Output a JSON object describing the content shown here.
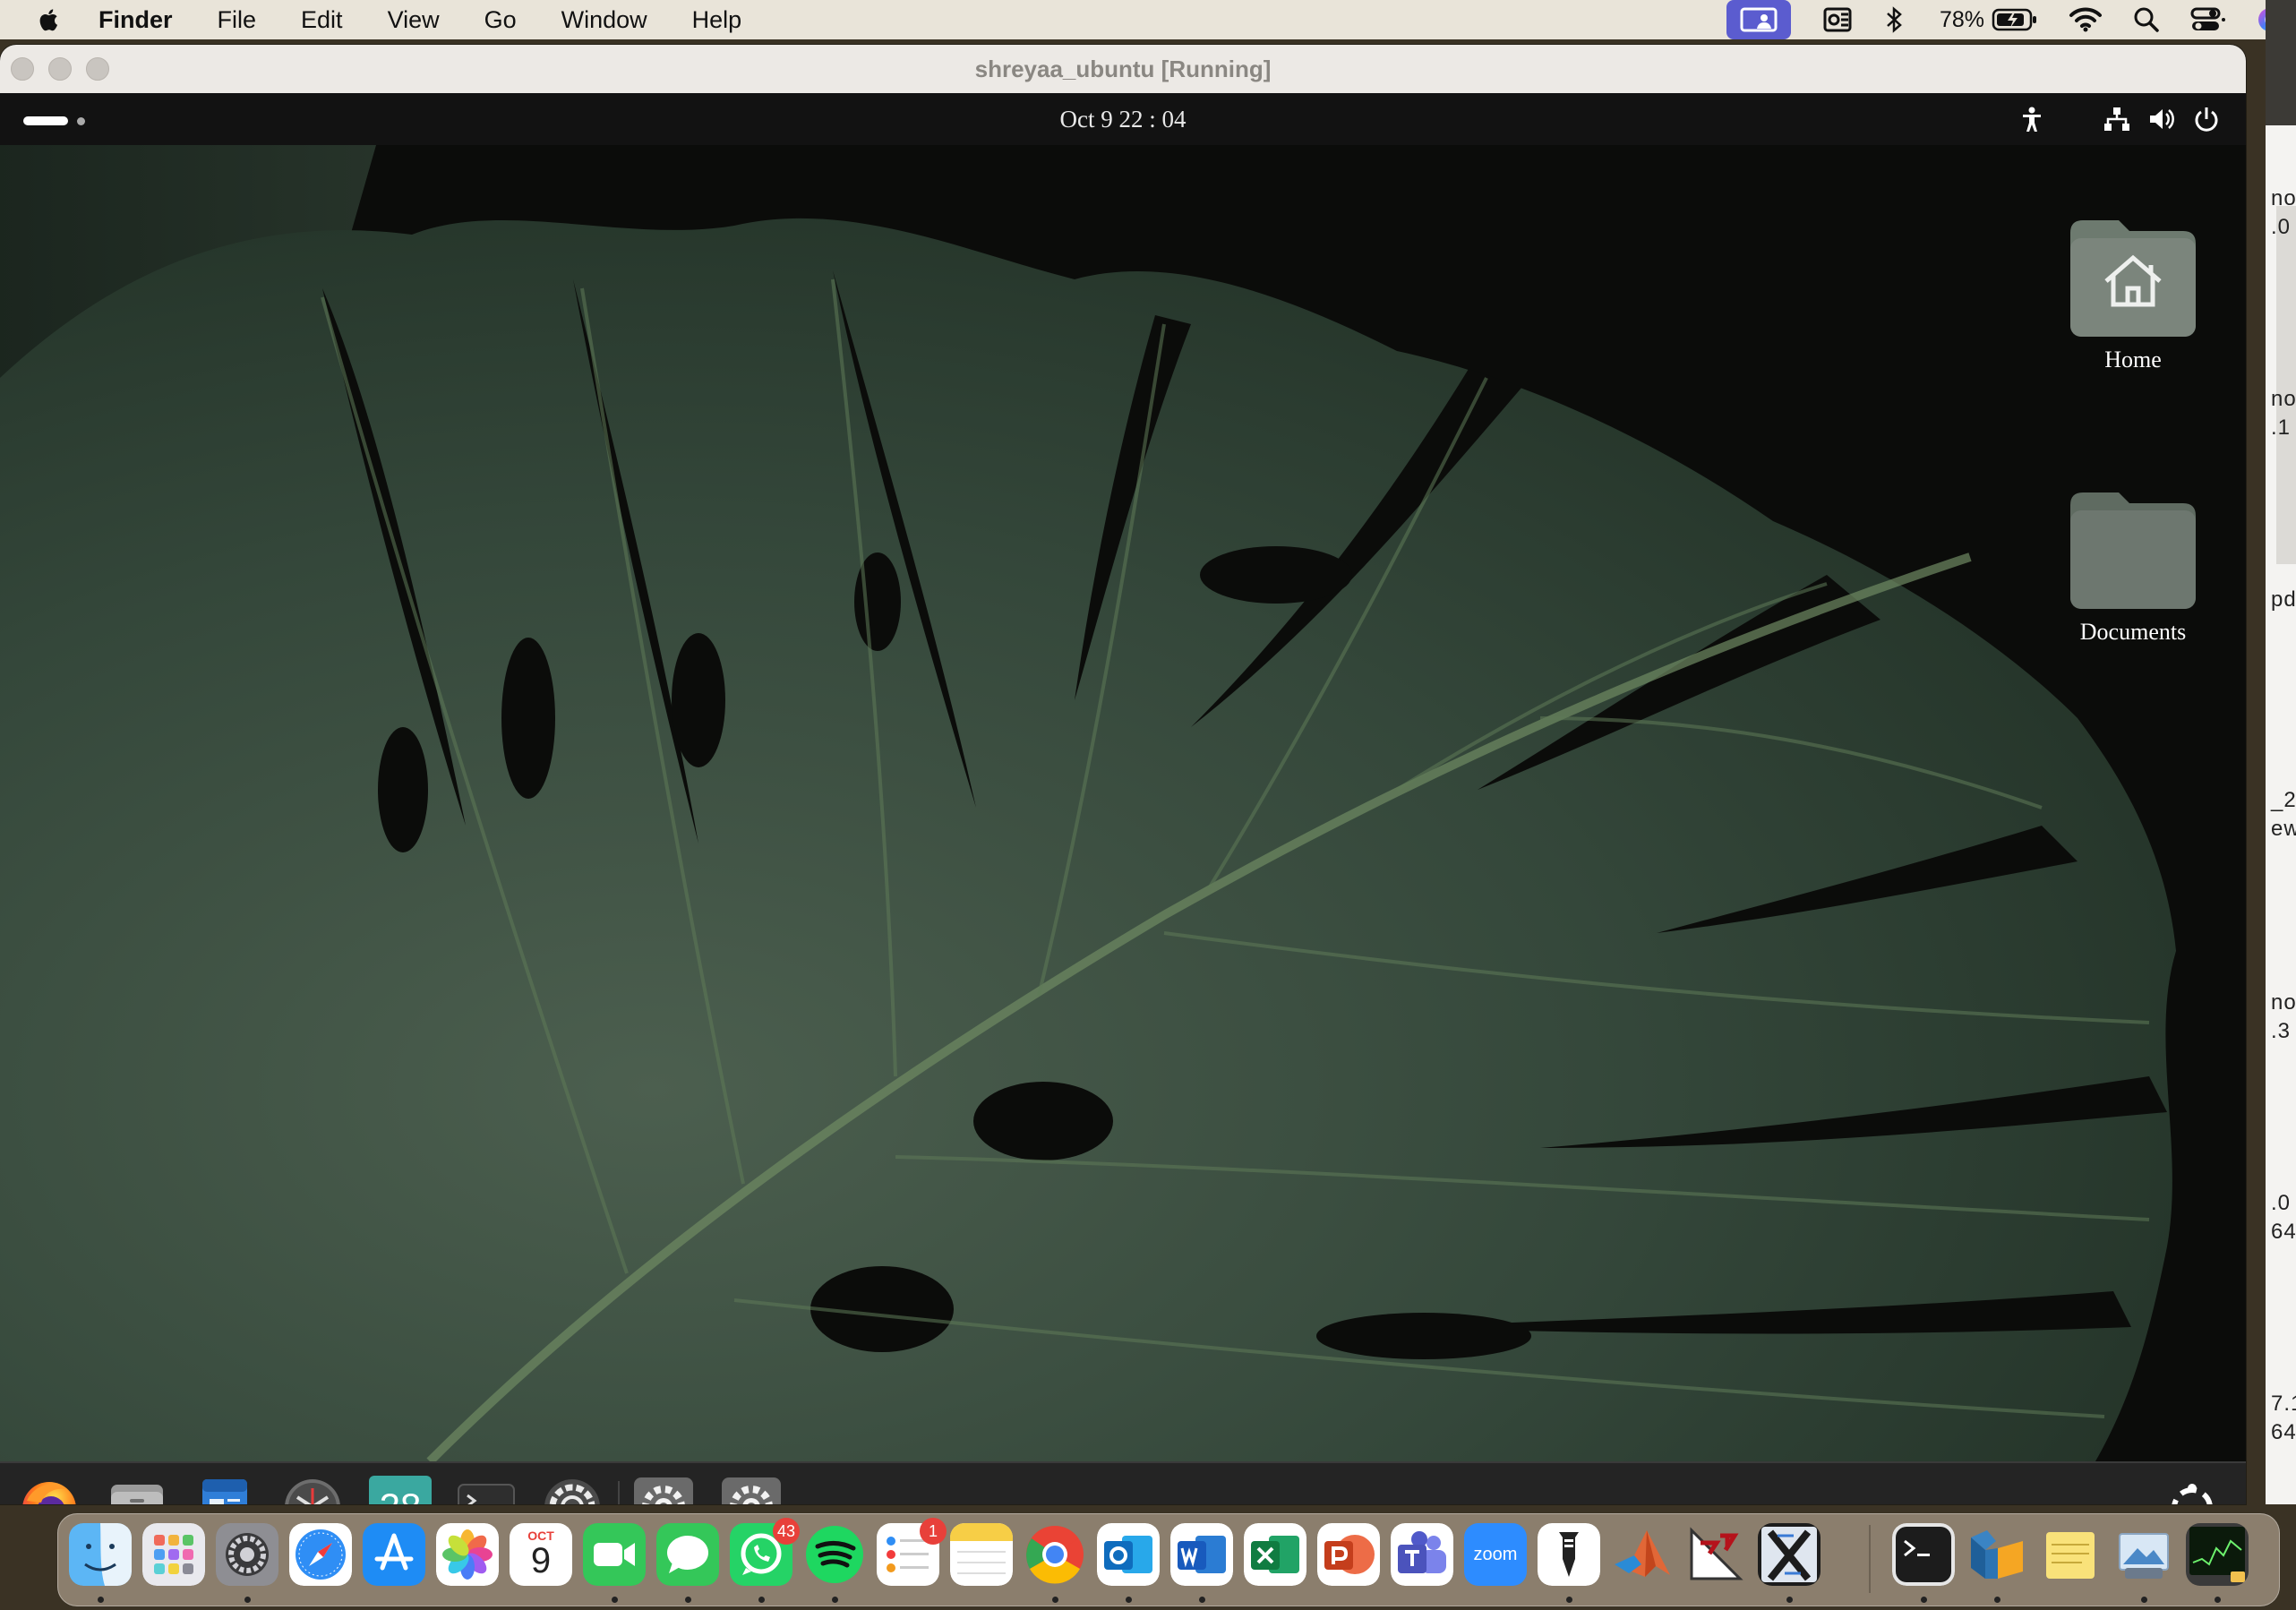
{
  "mac_menubar": {
    "app_name": "Finder",
    "menus": [
      "File",
      "Edit",
      "View",
      "Go",
      "Window",
      "Help"
    ],
    "battery_percent": "78%",
    "status_icons": [
      "screen-sharing-icon",
      "outlook-status-icon",
      "bluetooth-icon",
      "battery-icon",
      "wifi-icon",
      "spotlight-search-icon",
      "control-center-icon",
      "siri-icon"
    ]
  },
  "vm_window": {
    "title": "shreyaa_ubuntu [Running]"
  },
  "ubuntu_topbar": {
    "clock": "Oct 9  22 : 04",
    "icons": [
      "accessibility-icon",
      "network-icon",
      "volume-icon",
      "power-icon"
    ]
  },
  "desktop_icons": [
    {
      "label": "Home",
      "icon": "home-folder-icon"
    },
    {
      "label": "Documents",
      "icon": "folder-icon"
    }
  ],
  "ubuntu_dock": {
    "apps": [
      "Firefox",
      "Files",
      "Text Editor",
      "Clock",
      "Calendar",
      "Terminal",
      "Settings",
      "Settings",
      "Settings"
    ],
    "calendar_day": "28",
    "show_apps": "show-applications-icon"
  },
  "mac_dock": {
    "apps": [
      "Finder",
      "Launchpad",
      "System Settings",
      "Safari",
      "App Store",
      "Photos",
      "Calendar",
      "FaceTime",
      "Messages",
      "WhatsApp",
      "Spotify",
      "Reminders",
      "Notes",
      "Google Chrome",
      "Microsoft Outlook",
      "Microsoft Word",
      "Microsoft Excel",
      "Microsoft PowerPoint",
      "Microsoft Teams",
      "Zoom",
      "Typora",
      "MATLAB",
      "LTspice",
      "XQuartz",
      "Terminal",
      "VirtualBox",
      "Stickies",
      "Preview",
      "Activity Monitor"
    ],
    "calendar_month": "OCT",
    "calendar_day": "9",
    "whatsapp_badge": "43",
    "reminders_badge": "1",
    "zoom_label": "zoom"
  },
  "background_sliver_text": [
    "no",
    ".0",
    "no",
    ".1",
    "pd",
    "_2(",
    "ew",
    "no",
    ".3",
    ".0",
    "64",
    "7.1",
    "64."
  ]
}
